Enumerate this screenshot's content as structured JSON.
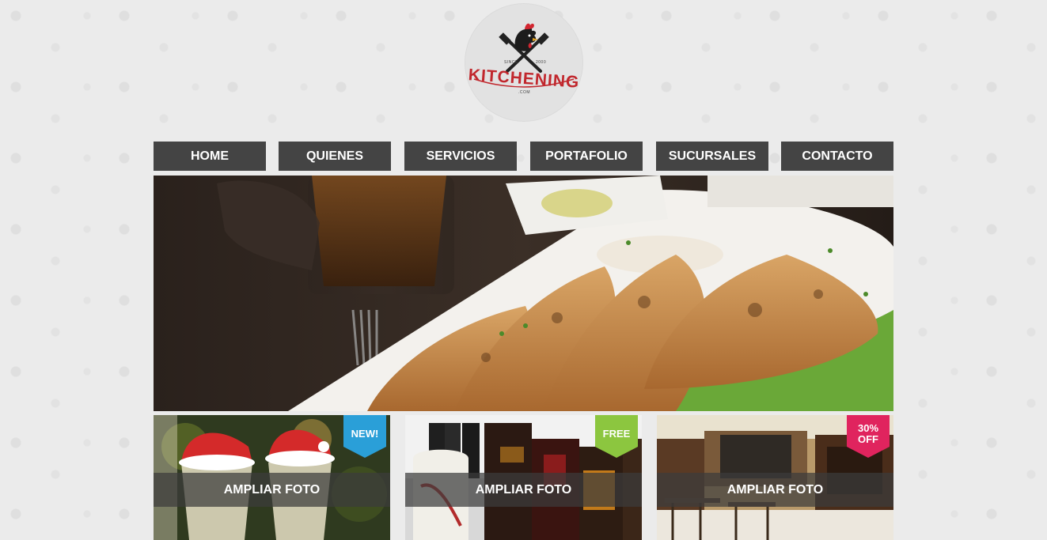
{
  "logo": {
    "brand": "KITCHENING",
    "since": "SINCE",
    "year": "2000",
    "domain": ".COM"
  },
  "nav": {
    "items": [
      {
        "label": "HOME"
      },
      {
        "label": "QUIENES"
      },
      {
        "label": "SERVICIOS"
      },
      {
        "label": "PORTAFOLIO"
      },
      {
        "label": "SUCURSALES"
      },
      {
        "label": "CONTACTO"
      }
    ]
  },
  "cards": [
    {
      "overlay": "AMPLIAR FOTO",
      "badge": "NEW!",
      "badge_color": "#2a9fd8"
    },
    {
      "overlay": "AMPLIAR FOTO",
      "badge": "FREE",
      "badge_color": "#8cc63f"
    },
    {
      "overlay": "AMPLIAR FOTO",
      "badge_line1": "30%",
      "badge_line2": "OFF",
      "badge_color": "#e0245e"
    }
  ],
  "colors": {
    "nav_bg": "#444444",
    "background": "#ebebeb",
    "brand_red": "#c1272d"
  }
}
